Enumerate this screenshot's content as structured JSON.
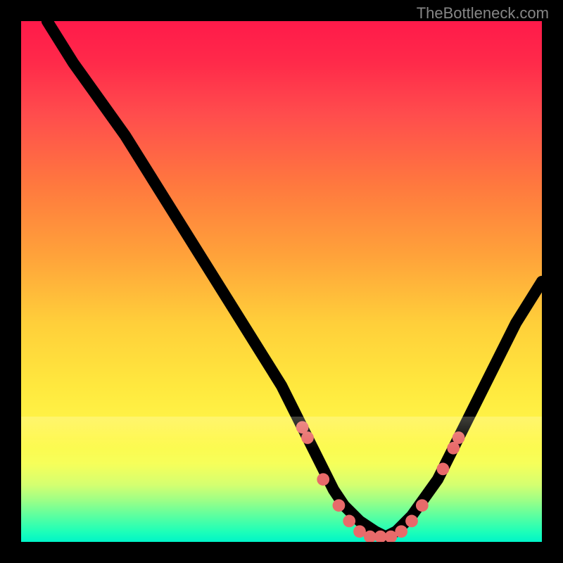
{
  "watermark": "TheBottleneck.com",
  "colors": {
    "background": "#000000",
    "gradient_top": "#ff1a4a",
    "gradient_mid": "#ffe83e",
    "gradient_bottom": "#00f5c8",
    "curve": "#000000",
    "dot": "#e86a6a"
  },
  "chart_data": {
    "type": "line",
    "title": "",
    "subtitle": "",
    "xlabel": "",
    "ylabel": "",
    "xlim": [
      0,
      100
    ],
    "ylim": [
      0,
      100
    ],
    "annotations": [],
    "legend": [],
    "series": [
      {
        "name": "bottleneck-curve",
        "x": [
          5,
          10,
          15,
          20,
          25,
          30,
          35,
          40,
          45,
          50,
          55,
          58,
          60,
          62,
          65,
          68,
          70,
          72,
          75,
          80,
          85,
          90,
          95,
          100
        ],
        "y": [
          100,
          92,
          85,
          78,
          70,
          62,
          54,
          46,
          38,
          30,
          20,
          14,
          10,
          7,
          4,
          2,
          1,
          2,
          5,
          12,
          22,
          32,
          42,
          50
        ]
      }
    ],
    "markers": [
      {
        "x": 54,
        "y": 22
      },
      {
        "x": 55,
        "y": 20
      },
      {
        "x": 58,
        "y": 12
      },
      {
        "x": 61,
        "y": 7
      },
      {
        "x": 63,
        "y": 4
      },
      {
        "x": 65,
        "y": 2
      },
      {
        "x": 67,
        "y": 1
      },
      {
        "x": 69,
        "y": 1
      },
      {
        "x": 71,
        "y": 1
      },
      {
        "x": 73,
        "y": 2
      },
      {
        "x": 75,
        "y": 4
      },
      {
        "x": 77,
        "y": 7
      },
      {
        "x": 81,
        "y": 14
      },
      {
        "x": 83,
        "y": 18
      },
      {
        "x": 84,
        "y": 20
      }
    ],
    "notes": "Axis units are normalized 0–100; chart has no visible axes, ticks, or labels. Values estimated from pixel positions on a 740×740 plot area."
  }
}
